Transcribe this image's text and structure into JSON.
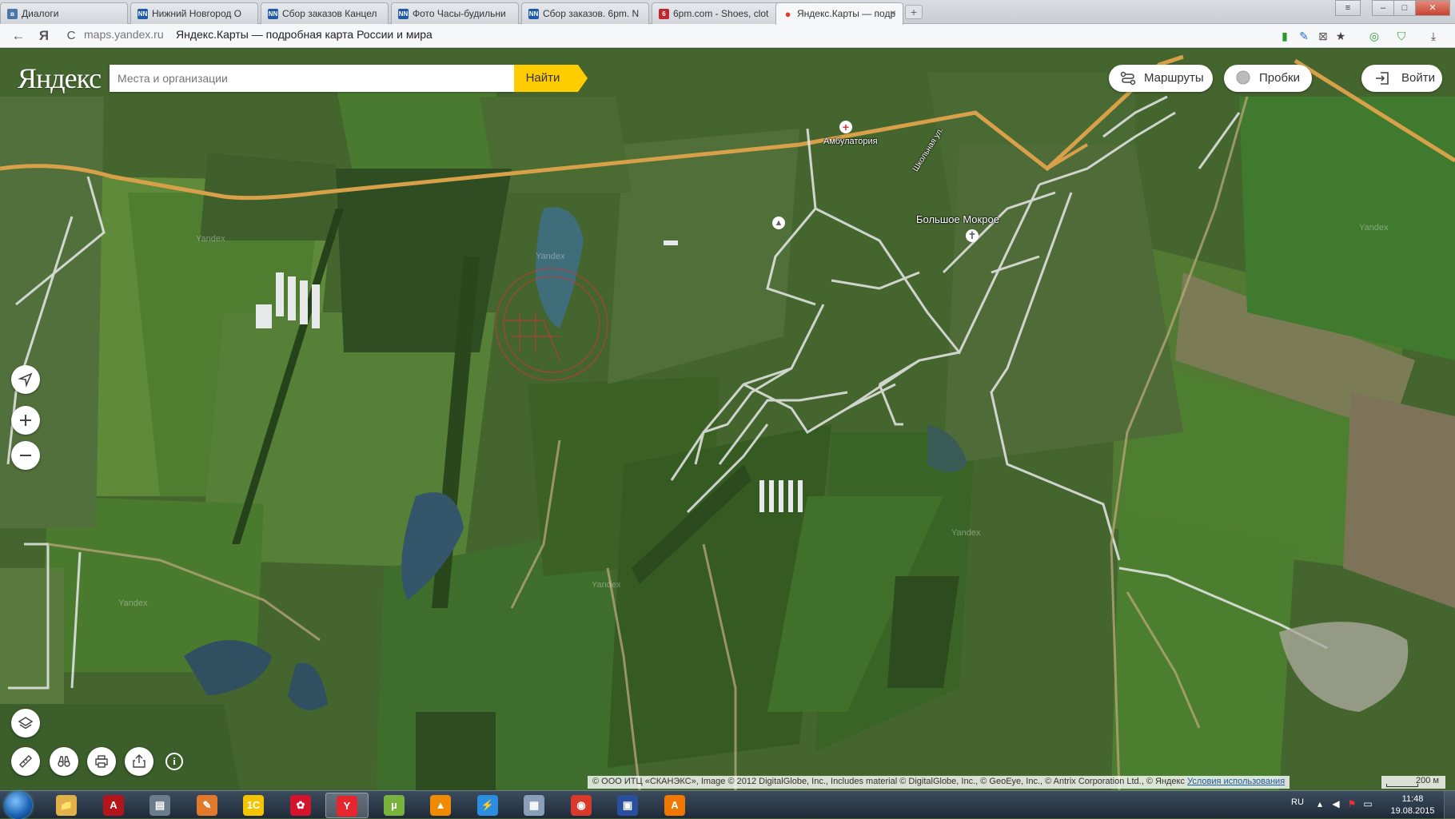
{
  "browser": {
    "tabs": [
      {
        "label": "Диалоги",
        "favicon": "vk",
        "color": "#4a76a8"
      },
      {
        "label": "Нижний Новгород О",
        "favicon": "nn",
        "color": "#1e5aa8"
      },
      {
        "label": "Сбор заказов Канцел",
        "favicon": "nn",
        "color": "#1e5aa8"
      },
      {
        "label": "Фото Часы-будильни",
        "favicon": "nn",
        "color": "#1e5aa8"
      },
      {
        "label": "Сбор заказов. 6pm. N",
        "favicon": "nn",
        "color": "#1e5aa8"
      },
      {
        "label": "6pm.com - Shoes, clot",
        "favicon": "6pm",
        "color": "#c2272d"
      },
      {
        "label": "Яндекс.Карты — подр",
        "favicon": "yandex-maps-pin",
        "color": "#e03b2b"
      }
    ],
    "tab_close": "×",
    "new_tab": "+",
    "window": {
      "menu": "≡",
      "minimize": "–",
      "maximize": "□",
      "close": "✕"
    },
    "nav": {
      "back": "←",
      "yandex": "Я",
      "reload": "C"
    },
    "url": "maps.yandex.ru",
    "page_title": "Яндекс.Карты — подробная карта России и мира"
  },
  "map": {
    "logo": "Яндекс",
    "search_placeholder": "Места и организации",
    "find_label": "Найти",
    "routes_label": "Маршруты",
    "traffic_label": "Пробки",
    "login_label": "Войти",
    "labels": {
      "ambulatory": "Амбулатория",
      "village": "Большое Мокрое",
      "street": "Школьная ул."
    },
    "watermark": "Yandex",
    "copyright": "© ООО ИТЦ «СКАНЭКС», Image © 2012 DigitalGlobe, Inc., Includes material © DigitalGlobe, Inc., © GeoEye, Inc., © Antrix Corporation Ltd., © Яндекс",
    "terms_link": "Условия использования",
    "scale": "200 м"
  },
  "taskbar": {
    "apps": [
      {
        "name": "explorer",
        "glyph": "📁",
        "color": "#e2b24a"
      },
      {
        "name": "acrobat",
        "glyph": "A",
        "color": "#b3151a"
      },
      {
        "name": "scanner",
        "glyph": "▤",
        "color": "#6b7c8d"
      },
      {
        "name": "paint",
        "glyph": "✎",
        "color": "#e07a2a"
      },
      {
        "name": "1c",
        "glyph": "1С",
        "color": "#f5c400"
      },
      {
        "name": "huawei",
        "glyph": "✿",
        "color": "#d4142c"
      },
      {
        "name": "yandex-browser",
        "glyph": "Y",
        "color": "#e6262e"
      },
      {
        "name": "utorrent",
        "glyph": "µ",
        "color": "#78b43d"
      },
      {
        "name": "vlc",
        "glyph": "▲",
        "color": "#f08a00"
      },
      {
        "name": "lightning",
        "glyph": "⚡",
        "color": "#2a8fe0"
      },
      {
        "name": "calculator",
        "glyph": "▦",
        "color": "#8aa0b8"
      },
      {
        "name": "chrome-like",
        "glyph": "◉",
        "color": "#d9392b"
      },
      {
        "name": "floppy",
        "glyph": "▣",
        "color": "#2a4f9e"
      },
      {
        "name": "avast",
        "glyph": "A",
        "color": "#f07800"
      }
    ],
    "lang": "RU",
    "time": "11:48",
    "date": "19.08.2015"
  }
}
